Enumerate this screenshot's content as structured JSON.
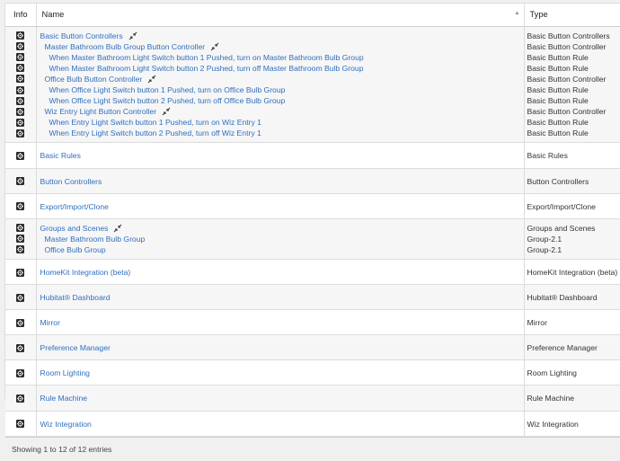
{
  "header": {
    "info": "Info",
    "name": "Name",
    "type": "Type",
    "sort_glyph": "▲"
  },
  "groups": [
    {
      "rows": [
        {
          "name": "Basic Button Controllers",
          "type": "Basic Button Controllers",
          "level": 0,
          "expand": true
        },
        {
          "name": "Master Bathroom Bulb Group Button Controller",
          "type": "Basic Button Controller",
          "level": 1,
          "expand": true
        },
        {
          "name": "When Master Bathroom Light Switch button 1 Pushed, turn on Master Bathroom Bulb Group",
          "type": "Basic Button Rule",
          "level": 2
        },
        {
          "name": "When Master Bathroom Light Switch button 2 Pushed, turn off Master Bathroom Bulb Group",
          "type": "Basic Button Rule",
          "level": 2
        },
        {
          "name": "Office Bulb Button Controller",
          "type": "Basic Button Controller",
          "level": 1,
          "expand": true
        },
        {
          "name": "When Office Light Switch button 1 Pushed, turn on Office Bulb Group",
          "type": "Basic Button Rule",
          "level": 2
        },
        {
          "name": "When Office Light Switch button 2 Pushed, turn off Office Bulb Group",
          "type": "Basic Button Rule",
          "level": 2
        },
        {
          "name": "Wiz Entry Light Button Controller",
          "type": "Basic Button Controller",
          "level": 1,
          "expand": true
        },
        {
          "name": "When Entry Light Switch button 1 Pushed, turn on Wiz Entry 1",
          "type": "Basic Button Rule",
          "level": 2
        },
        {
          "name": "When Entry Light Switch button 2 Pushed, turn off Wiz Entry 1",
          "type": "Basic Button Rule",
          "level": 2
        }
      ]
    },
    {
      "rows": [
        {
          "name": "Basic Rules",
          "type": "Basic Rules",
          "level": 0
        }
      ]
    },
    {
      "rows": [
        {
          "name": "Button Controllers",
          "type": "Button Controllers",
          "level": 0
        }
      ]
    },
    {
      "rows": [
        {
          "name": "Export/Import/Clone",
          "type": "Export/Import/Clone",
          "level": 0
        }
      ]
    },
    {
      "rows": [
        {
          "name": "Groups and Scenes",
          "type": "Groups and Scenes",
          "level": 0,
          "expand": true
        },
        {
          "name": "Master Bathroom Bulb Group",
          "type": "Group-2.1",
          "level": 1
        },
        {
          "name": "Office Bulb Group",
          "type": "Group-2.1",
          "level": 1
        }
      ]
    },
    {
      "rows": [
        {
          "name": "HomeKit Integration (beta)",
          "type": "HomeKit Integration (beta)",
          "level": 0
        }
      ]
    },
    {
      "rows": [
        {
          "name": "Hubitat® Dashboard",
          "type": "Hubitat® Dashboard",
          "level": 0
        }
      ]
    },
    {
      "rows": [
        {
          "name": "Mirror",
          "type": "Mirror",
          "level": 0
        }
      ]
    },
    {
      "rows": [
        {
          "name": "Preference Manager",
          "type": "Preference Manager",
          "level": 0
        }
      ]
    },
    {
      "rows": [
        {
          "name": "Room Lighting",
          "type": "Room Lighting",
          "level": 0
        }
      ]
    },
    {
      "rows": [
        {
          "name": "Rule Machine",
          "type": "Rule Machine",
          "level": 0
        }
      ]
    },
    {
      "rows": [
        {
          "name": "Wiz Integration",
          "type": "Wiz Integration",
          "level": 0
        }
      ]
    }
  ],
  "footer": {
    "entries_text": "Showing 1 to 12 of 12 entries"
  },
  "icons": {
    "settings": "gear-icon",
    "expand": "expand-arrows-icon"
  },
  "colors": {
    "link": "#2f6fbf",
    "stripe": "#f6f6f6",
    "border": "#dcdcdc"
  }
}
